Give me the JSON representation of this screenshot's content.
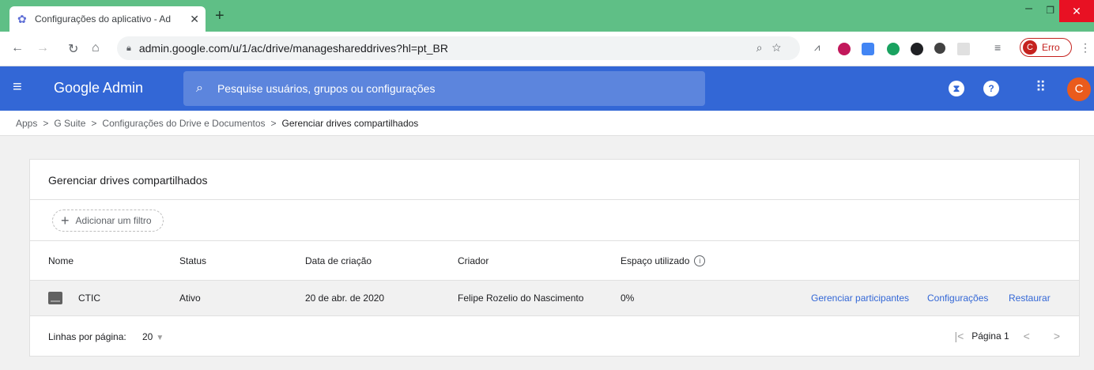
{
  "browser": {
    "tab_title": "Configurações do aplicativo - Ad",
    "url": "admin.google.com/u/1/ac/drive/manageshareddrives?hl=pt_BR",
    "profile_initial": "C",
    "profile_status": "Erro"
  },
  "header": {
    "brand": "Google Admin",
    "search_placeholder": "Pesquise usuários, grupos ou configurações",
    "avatar_initial": "C"
  },
  "breadcrumb": [
    "Apps",
    "G Suite",
    "Configurações do Drive e Documentos",
    "Gerenciar drives compartilhados"
  ],
  "card": {
    "title": "Gerenciar drives compartilhados",
    "add_filter": "Adicionar um filtro",
    "columns": [
      "Nome",
      "Status",
      "Data de criação",
      "Criador",
      "Espaço utilizado"
    ],
    "rows": [
      {
        "name": "CTIC",
        "status": "Ativo",
        "created": "20 de abr. de 2020",
        "creator": "Felipe Rozelio do Nascimento",
        "usage": "0%",
        "actions": [
          "Gerenciar participantes",
          "Configurações",
          "Restaurar"
        ]
      }
    ],
    "rows_per_page_label": "Linhas por página:",
    "rows_per_page": "20",
    "page_label": "Página 1"
  },
  "colors": {
    "header_bg": "#3367d6",
    "tabstrip_bg": "#5fbf86",
    "link": "#3367d6",
    "avatar": "#ea5b1c"
  }
}
